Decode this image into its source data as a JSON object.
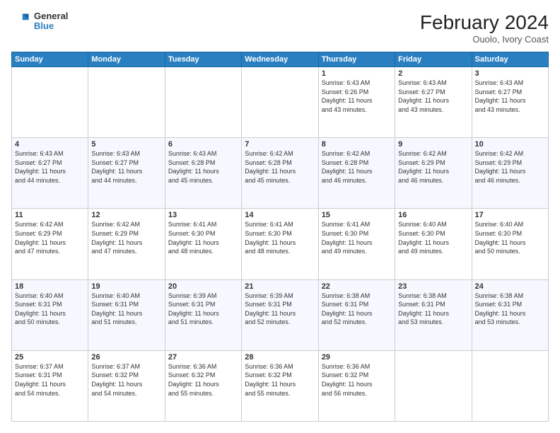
{
  "logo": {
    "line1": "General",
    "line2": "Blue"
  },
  "title": "February 2024",
  "subtitle": "Ouolo, Ivory Coast",
  "days_header": [
    "Sunday",
    "Monday",
    "Tuesday",
    "Wednesday",
    "Thursday",
    "Friday",
    "Saturday"
  ],
  "weeks": [
    [
      {
        "day": "",
        "info": ""
      },
      {
        "day": "",
        "info": ""
      },
      {
        "day": "",
        "info": ""
      },
      {
        "day": "",
        "info": ""
      },
      {
        "day": "1",
        "info": "Sunrise: 6:43 AM\nSunset: 6:26 PM\nDaylight: 11 hours\nand 43 minutes."
      },
      {
        "day": "2",
        "info": "Sunrise: 6:43 AM\nSunset: 6:27 PM\nDaylight: 11 hours\nand 43 minutes."
      },
      {
        "day": "3",
        "info": "Sunrise: 6:43 AM\nSunset: 6:27 PM\nDaylight: 11 hours\nand 43 minutes."
      }
    ],
    [
      {
        "day": "4",
        "info": "Sunrise: 6:43 AM\nSunset: 6:27 PM\nDaylight: 11 hours\nand 44 minutes."
      },
      {
        "day": "5",
        "info": "Sunrise: 6:43 AM\nSunset: 6:27 PM\nDaylight: 11 hours\nand 44 minutes."
      },
      {
        "day": "6",
        "info": "Sunrise: 6:43 AM\nSunset: 6:28 PM\nDaylight: 11 hours\nand 45 minutes."
      },
      {
        "day": "7",
        "info": "Sunrise: 6:42 AM\nSunset: 6:28 PM\nDaylight: 11 hours\nand 45 minutes."
      },
      {
        "day": "8",
        "info": "Sunrise: 6:42 AM\nSunset: 6:28 PM\nDaylight: 11 hours\nand 46 minutes."
      },
      {
        "day": "9",
        "info": "Sunrise: 6:42 AM\nSunset: 6:29 PM\nDaylight: 11 hours\nand 46 minutes."
      },
      {
        "day": "10",
        "info": "Sunrise: 6:42 AM\nSunset: 6:29 PM\nDaylight: 11 hours\nand 46 minutes."
      }
    ],
    [
      {
        "day": "11",
        "info": "Sunrise: 6:42 AM\nSunset: 6:29 PM\nDaylight: 11 hours\nand 47 minutes."
      },
      {
        "day": "12",
        "info": "Sunrise: 6:42 AM\nSunset: 6:29 PM\nDaylight: 11 hours\nand 47 minutes."
      },
      {
        "day": "13",
        "info": "Sunrise: 6:41 AM\nSunset: 6:30 PM\nDaylight: 11 hours\nand 48 minutes."
      },
      {
        "day": "14",
        "info": "Sunrise: 6:41 AM\nSunset: 6:30 PM\nDaylight: 11 hours\nand 48 minutes."
      },
      {
        "day": "15",
        "info": "Sunrise: 6:41 AM\nSunset: 6:30 PM\nDaylight: 11 hours\nand 49 minutes."
      },
      {
        "day": "16",
        "info": "Sunrise: 6:40 AM\nSunset: 6:30 PM\nDaylight: 11 hours\nand 49 minutes."
      },
      {
        "day": "17",
        "info": "Sunrise: 6:40 AM\nSunset: 6:30 PM\nDaylight: 11 hours\nand 50 minutes."
      }
    ],
    [
      {
        "day": "18",
        "info": "Sunrise: 6:40 AM\nSunset: 6:31 PM\nDaylight: 11 hours\nand 50 minutes."
      },
      {
        "day": "19",
        "info": "Sunrise: 6:40 AM\nSunset: 6:31 PM\nDaylight: 11 hours\nand 51 minutes."
      },
      {
        "day": "20",
        "info": "Sunrise: 6:39 AM\nSunset: 6:31 PM\nDaylight: 11 hours\nand 51 minutes."
      },
      {
        "day": "21",
        "info": "Sunrise: 6:39 AM\nSunset: 6:31 PM\nDaylight: 11 hours\nand 52 minutes."
      },
      {
        "day": "22",
        "info": "Sunrise: 6:38 AM\nSunset: 6:31 PM\nDaylight: 11 hours\nand 52 minutes."
      },
      {
        "day": "23",
        "info": "Sunrise: 6:38 AM\nSunset: 6:31 PM\nDaylight: 11 hours\nand 53 minutes."
      },
      {
        "day": "24",
        "info": "Sunrise: 6:38 AM\nSunset: 6:31 PM\nDaylight: 11 hours\nand 53 minutes."
      }
    ],
    [
      {
        "day": "25",
        "info": "Sunrise: 6:37 AM\nSunset: 6:31 PM\nDaylight: 11 hours\nand 54 minutes."
      },
      {
        "day": "26",
        "info": "Sunrise: 6:37 AM\nSunset: 6:32 PM\nDaylight: 11 hours\nand 54 minutes."
      },
      {
        "day": "27",
        "info": "Sunrise: 6:36 AM\nSunset: 6:32 PM\nDaylight: 11 hours\nand 55 minutes."
      },
      {
        "day": "28",
        "info": "Sunrise: 6:36 AM\nSunset: 6:32 PM\nDaylight: 11 hours\nand 55 minutes."
      },
      {
        "day": "29",
        "info": "Sunrise: 6:36 AM\nSunset: 6:32 PM\nDaylight: 11 hours\nand 56 minutes."
      },
      {
        "day": "",
        "info": ""
      },
      {
        "day": "",
        "info": ""
      }
    ]
  ]
}
